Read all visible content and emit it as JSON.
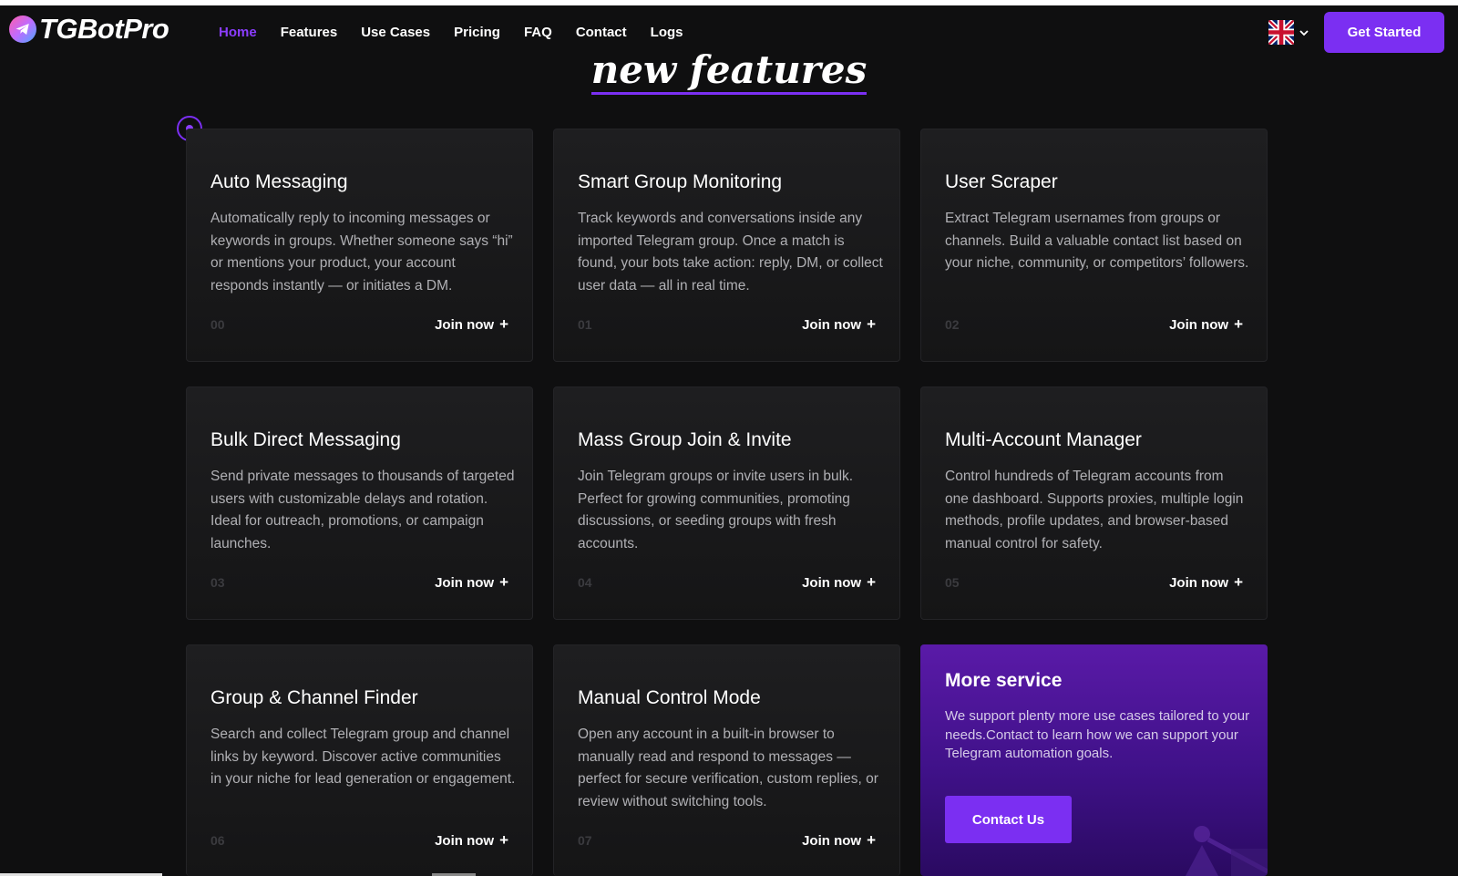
{
  "brand": {
    "name": "TGBotPro"
  },
  "nav": {
    "items": [
      {
        "label": "Home",
        "active": true
      },
      {
        "label": "Features"
      },
      {
        "label": "Use Cases"
      },
      {
        "label": "Pricing"
      },
      {
        "label": "FAQ"
      },
      {
        "label": "Contact"
      },
      {
        "label": "Logs"
      }
    ],
    "language_icon": "uk-flag-icon",
    "cta_label": "Get Started"
  },
  "section": {
    "heading": "new features"
  },
  "cards": [
    {
      "title": "Auto Messaging",
      "description": "Automatically reply to incoming messages or keywords in groups. Whether someone says “hi” or mentions your product, your account responds instantly — or initiates a DM.",
      "number": "00",
      "link": "Join now"
    },
    {
      "title": "Smart Group Monitoring",
      "description": "Track keywords and conversations inside any imported Telegram group. Once a match is found, your bots take action: reply, DM, or collect user data — all in real time.",
      "number": "01",
      "link": "Join now"
    },
    {
      "title": "User Scraper",
      "description": "Extract Telegram usernames from groups or channels. Build a valuable contact list based on your niche, community, or competitors’ followers.",
      "number": "02",
      "link": "Join now"
    },
    {
      "title": "Bulk Direct Messaging",
      "description": "Send private messages to thousands of targeted users with customizable delays and rotation. Ideal for outreach, promotions, or campaign launches.",
      "number": "03",
      "link": "Join now"
    },
    {
      "title": "Mass Group Join & Invite",
      "description": "Join Telegram groups or invite users in bulk. Perfect for growing communities, promoting discussions, or seeding groups with fresh accounts.",
      "number": "04",
      "link": "Join now"
    },
    {
      "title": "Multi-Account Manager",
      "description": "Control hundreds of Telegram accounts from one dashboard. Supports proxies, multiple login methods, profile updates, and browser-based manual control for safety.",
      "number": "05",
      "link": "Join now"
    },
    {
      "title": "Group & Channel Finder",
      "description": "Search and collect Telegram group and channel links by keyword. Discover active communities in your niche for lead generation or engagement.",
      "number": "06",
      "link": "Join now"
    },
    {
      "title": "Manual Control Mode",
      "description": "Open any account in a built-in browser to manually read and respond to messages — perfect for secure verification, custom replies, or review without switching tools.",
      "number": "07",
      "link": "Join now"
    }
  ],
  "more_service": {
    "title": "More service",
    "description": "We support plenty more use cases tailored to your needs.Contact to learn how we can support your Telegram automation goals.",
    "button_label": "Contact Us"
  },
  "colors": {
    "accent": "#7b2ff2",
    "active_nav": "#8b3dff",
    "background": "#0f0f10",
    "card_bg": "#1c1c1e"
  }
}
